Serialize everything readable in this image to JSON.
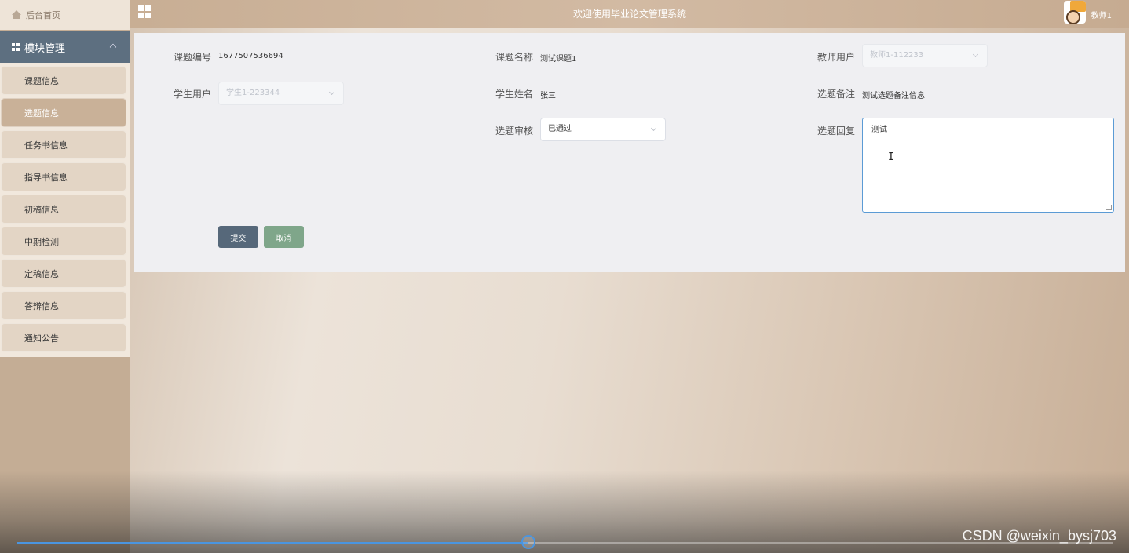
{
  "sidebar": {
    "home_label": "后台首页",
    "module_label": "模块管理",
    "items": [
      {
        "label": "课题信息",
        "active": false
      },
      {
        "label": "选题信息",
        "active": true
      },
      {
        "label": "任务书信息",
        "active": false
      },
      {
        "label": "指导书信息",
        "active": false
      },
      {
        "label": "初稿信息",
        "active": false
      },
      {
        "label": "中期检测",
        "active": false
      },
      {
        "label": "定稿信息",
        "active": false
      },
      {
        "label": "答辩信息",
        "active": false
      },
      {
        "label": "通知公告",
        "active": false
      }
    ]
  },
  "topbar": {
    "title": "欢迎使用毕业论文管理系统",
    "username": "教师1"
  },
  "form": {
    "topic_no": {
      "label": "课题编号",
      "value": "1677507536694"
    },
    "topic_name": {
      "label": "课题名称",
      "value": "测试课题1"
    },
    "teacher_user": {
      "label": "教师用户",
      "value": "教师1-112233"
    },
    "student_user": {
      "label": "学生用户",
      "value": "学生1-223344"
    },
    "student_name": {
      "label": "学生姓名",
      "value": "张三"
    },
    "selection_note": {
      "label": "选题备注",
      "value": "测试选题备注信息"
    },
    "review": {
      "label": "选题审核",
      "value": "已通过"
    },
    "reply": {
      "label": "选题回复",
      "value": "测试"
    },
    "submit_label": "提交",
    "cancel_label": "取消"
  },
  "video": {
    "progress_fraction": 0.467
  },
  "watermark": "CSDN @weixin_bysj703",
  "colors": {
    "sidebar_active": "#c9b198",
    "module_header": "#5d6f80",
    "submit": "#56687a",
    "cancel": "#7fa68a",
    "progress": "#4a95e0"
  }
}
